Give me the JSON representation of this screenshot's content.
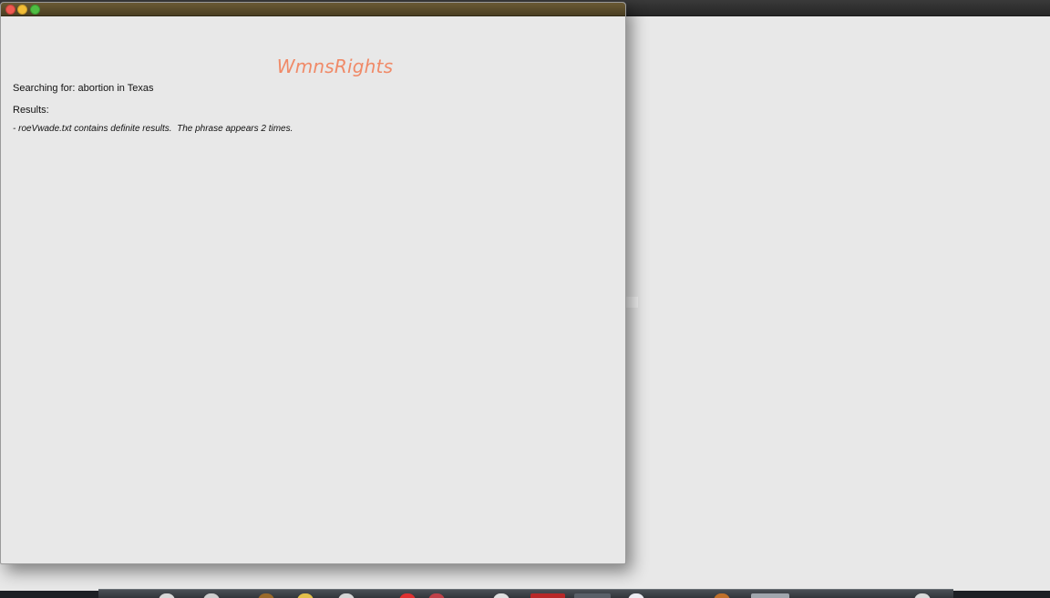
{
  "window": {
    "app_title": "WmnsRights",
    "search_prefix": "Searching for: ",
    "search_query": "abortion in Texas",
    "results_label": "Results:",
    "results": [
      "- roeVwade.txt contains definite results.  The phrase appears 2 times."
    ]
  },
  "colors": {
    "title_accent": "#f08a68",
    "titlebar": "#5a4b2b",
    "window_bg": "#e8e8e8"
  },
  "dock": {
    "icons": [
      "app-icon",
      "app-icon",
      "app-icon",
      "app-icon",
      "app-icon",
      "app-icon",
      "app-icon",
      "app-icon",
      "app-icon",
      "app-icon",
      "app-icon",
      "app-icon",
      "app-icon",
      "app-icon",
      "app-icon",
      "app-icon",
      "app-icon",
      "app-icon"
    ]
  }
}
